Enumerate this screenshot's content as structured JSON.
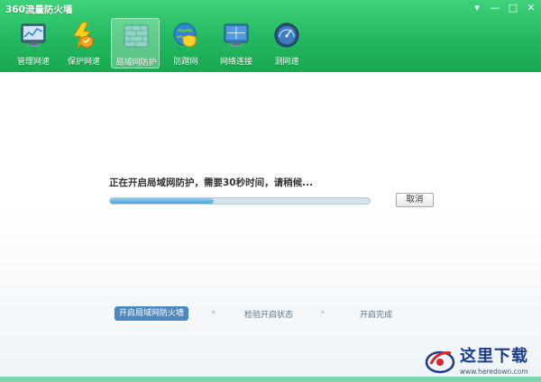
{
  "window": {
    "title": "360流量防火墙",
    "controls": {
      "menu": "▾",
      "minimize": "—",
      "maximize": "□",
      "close": "✕"
    }
  },
  "tabs": [
    {
      "label": "管理网速",
      "icon": "monitor-chart-icon"
    },
    {
      "label": "保护网速",
      "icon": "lightning-shield-icon"
    },
    {
      "label": "局域网防护",
      "icon": "firewall-wall-icon",
      "active": true
    },
    {
      "label": "防蹭网",
      "icon": "globe-shield-icon"
    },
    {
      "label": "网络连接",
      "icon": "network-monitor-icon"
    },
    {
      "label": "测网速",
      "icon": "speedometer-icon"
    }
  ],
  "main": {
    "status_text": "正在开启局域网防护，需要30秒时间，请稍候...",
    "progress": 0.4,
    "cancel_label": "取消"
  },
  "steps": [
    {
      "label": "开启局域网防火墙",
      "active": true
    },
    {
      "label": "检验开启状态",
      "active": false
    },
    {
      "label": "开启完成",
      "active": false
    }
  ],
  "step_separator": "»",
  "watermark": {
    "chinese": "这里下载",
    "url": "www.heredown.com"
  },
  "colors": {
    "header_green": "#22b85f",
    "active_step": "#4d87c0",
    "progress_fill": "#4aa3dd"
  }
}
